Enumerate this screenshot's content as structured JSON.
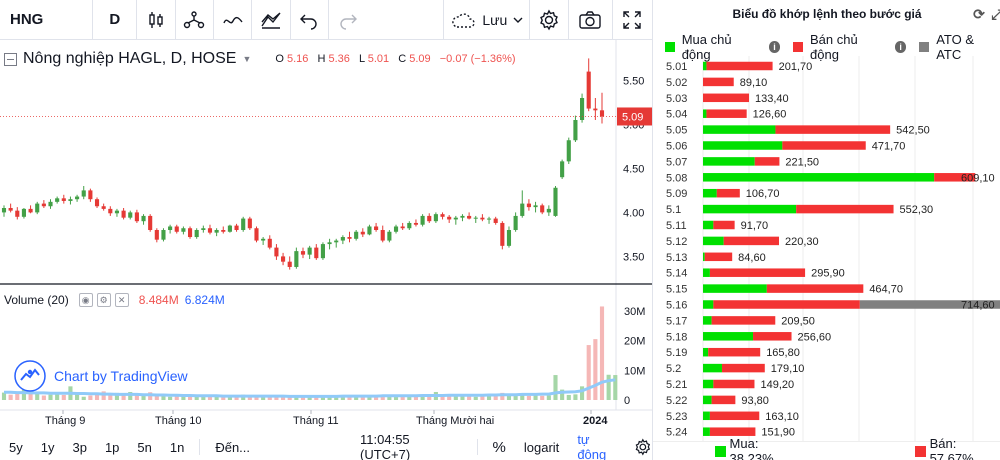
{
  "toolbar": {
    "symbol": "HNG",
    "interval": "D",
    "save_label": "Lưu"
  },
  "legend": {
    "title": "Nông nghiệp HAGL, D, HOSE",
    "o_key": "O",
    "o_val": "5.16",
    "h_key": "H",
    "h_val": "5.36",
    "l_key": "L",
    "l_val": "5.01",
    "c_key": "C",
    "c_val": "5.09",
    "change": "−0.07 (−1.36%)"
  },
  "volume_legend": {
    "label": "Volume (20)",
    "vol": "8.484M",
    "ma": "6.824M"
  },
  "watermark": "Chart by TradingView",
  "bottom": {
    "ranges": [
      "5y",
      "1y",
      "3p",
      "1p",
      "5n",
      "1n"
    ],
    "goto": "Đến...",
    "time": "11:04:55 (UTC+7)",
    "percent": "%",
    "log": "logarit",
    "auto": "tự động"
  },
  "colors": {
    "up": "#26a69a",
    "down": "#ef5350",
    "upCandle": "#43a047",
    "downCandle": "#e53935",
    "buy": "#00e000",
    "sell": "#f33333",
    "ato": "#808080",
    "accent": "#2962ff"
  },
  "chart_data": [
    {
      "type": "candlestick",
      "title": "Nông nghiệp HAGL, D, HOSE",
      "current_price": 5.09,
      "y_ticks": [
        "5.50",
        "5.00",
        "4.50",
        "4.00",
        "3.50"
      ],
      "ylim": [
        3.3,
        5.8
      ],
      "x_labels": [
        "Tháng 9",
        "Tháng 10",
        "Tháng 11",
        "Tháng Mười hai",
        "2024"
      ],
      "candles": [
        [
          4.0,
          4.08,
          3.95,
          4.05
        ],
        [
          4.05,
          4.1,
          4.0,
          4.02
        ],
        [
          4.02,
          4.06,
          3.92,
          3.95
        ],
        [
          3.95,
          4.05,
          3.93,
          4.04
        ],
        [
          4.04,
          4.08,
          3.99,
          4.0
        ],
        [
          4.0,
          4.12,
          3.98,
          4.1
        ],
        [
          4.1,
          4.14,
          4.05,
          4.07
        ],
        [
          4.07,
          4.15,
          4.04,
          4.12
        ],
        [
          4.12,
          4.18,
          4.1,
          4.16
        ],
        [
          4.16,
          4.2,
          4.1,
          4.13
        ],
        [
          4.13,
          4.18,
          4.09,
          4.15
        ],
        [
          4.15,
          4.2,
          4.12,
          4.18
        ],
        [
          4.18,
          4.3,
          4.15,
          4.25
        ],
        [
          4.25,
          4.27,
          4.12,
          4.15
        ],
        [
          4.15,
          4.17,
          4.05,
          4.07
        ],
        [
          4.07,
          4.1,
          4.02,
          4.04
        ],
        [
          4.04,
          4.07,
          3.96,
          3.99
        ],
        [
          3.99,
          4.04,
          3.95,
          4.02
        ],
        [
          4.02,
          4.05,
          3.92,
          3.94
        ],
        [
          3.94,
          4.02,
          3.92,
          4.0
        ],
        [
          4.0,
          4.03,
          3.88,
          3.9
        ],
        [
          3.9,
          3.98,
          3.86,
          3.96
        ],
        [
          3.96,
          3.98,
          3.78,
          3.8
        ],
        [
          3.8,
          3.82,
          3.66,
          3.69
        ],
        [
          3.69,
          3.82,
          3.67,
          3.8
        ],
        [
          3.8,
          3.86,
          3.76,
          3.84
        ],
        [
          3.84,
          3.86,
          3.76,
          3.78
        ],
        [
          3.78,
          3.84,
          3.75,
          3.82
        ],
        [
          3.82,
          3.84,
          3.7,
          3.72
        ],
        [
          3.72,
          3.82,
          3.7,
          3.8
        ],
        [
          3.8,
          3.85,
          3.77,
          3.82
        ],
        [
          3.82,
          3.86,
          3.75,
          3.77
        ],
        [
          3.77,
          3.82,
          3.73,
          3.8
        ],
        [
          3.8,
          3.84,
          3.76,
          3.78
        ],
        [
          3.78,
          3.86,
          3.77,
          3.85
        ],
        [
          3.85,
          3.87,
          3.78,
          3.8
        ],
        [
          3.8,
          3.95,
          3.78,
          3.93
        ],
        [
          3.93,
          3.95,
          3.8,
          3.82
        ],
        [
          3.82,
          3.84,
          3.66,
          3.68
        ],
        [
          3.68,
          3.72,
          3.63,
          3.7
        ],
        [
          3.7,
          3.74,
          3.58,
          3.6
        ],
        [
          3.6,
          3.64,
          3.46,
          3.5
        ],
        [
          3.5,
          3.54,
          3.4,
          3.44
        ],
        [
          3.44,
          3.5,
          3.35,
          3.38
        ],
        [
          3.38,
          3.6,
          3.36,
          3.56
        ],
        [
          3.56,
          3.6,
          3.48,
          3.52
        ],
        [
          3.52,
          3.62,
          3.47,
          3.6
        ],
        [
          3.6,
          3.64,
          3.46,
          3.48
        ],
        [
          3.48,
          3.66,
          3.46,
          3.64
        ],
        [
          3.64,
          3.7,
          3.58,
          3.66
        ],
        [
          3.66,
          3.7,
          3.6,
          3.68
        ],
        [
          3.68,
          3.74,
          3.64,
          3.72
        ],
        [
          3.72,
          3.78,
          3.66,
          3.7
        ],
        [
          3.7,
          3.8,
          3.68,
          3.78
        ],
        [
          3.78,
          3.82,
          3.72,
          3.75
        ],
        [
          3.75,
          3.86,
          3.74,
          3.84
        ],
        [
          3.84,
          3.88,
          3.78,
          3.8
        ],
        [
          3.8,
          3.85,
          3.66,
          3.68
        ],
        [
          3.68,
          3.8,
          3.66,
          3.78
        ],
        [
          3.78,
          3.86,
          3.76,
          3.84
        ],
        [
          3.84,
          3.88,
          3.8,
          3.82
        ],
        [
          3.82,
          3.9,
          3.8,
          3.88
        ],
        [
          3.88,
          3.92,
          3.84,
          3.86
        ],
        [
          3.86,
          3.98,
          3.84,
          3.96
        ],
        [
          3.96,
          3.99,
          3.88,
          3.9
        ],
        [
          3.9,
          4.0,
          3.88,
          3.98
        ],
        [
          3.98,
          4.0,
          3.92,
          3.95
        ],
        [
          3.95,
          3.97,
          3.88,
          3.92
        ],
        [
          3.92,
          3.96,
          3.86,
          3.94
        ],
        [
          3.94,
          3.98,
          3.9,
          3.96
        ],
        [
          3.96,
          4.0,
          3.92,
          3.93
        ],
        [
          3.93,
          3.96,
          3.88,
          3.94
        ],
        [
          3.94,
          3.98,
          3.9,
          3.92
        ],
        [
          3.92,
          3.95,
          3.87,
          3.93
        ],
        [
          3.93,
          3.95,
          3.86,
          3.88
        ],
        [
          3.88,
          3.9,
          3.58,
          3.62
        ],
        [
          3.62,
          3.84,
          3.6,
          3.8
        ],
        [
          3.8,
          4.0,
          3.78,
          3.96
        ],
        [
          3.96,
          4.25,
          3.94,
          4.1
        ],
        [
          4.1,
          4.15,
          4.02,
          4.06
        ],
        [
          4.06,
          4.12,
          4.0,
          4.08
        ],
        [
          4.08,
          4.1,
          3.98,
          4.0
        ],
        [
          4.0,
          4.08,
          3.96,
          4.04
        ],
        [
          3.96,
          4.3,
          3.95,
          4.28
        ],
        [
          4.4,
          4.6,
          4.38,
          4.58
        ],
        [
          4.58,
          4.85,
          4.55,
          4.82
        ],
        [
          4.82,
          5.1,
          4.8,
          5.05
        ],
        [
          5.05,
          5.35,
          5.02,
          5.3
        ],
        [
          5.6,
          5.75,
          5.15,
          5.18
        ],
        [
          5.18,
          5.3,
          5.05,
          5.16
        ],
        [
          5.16,
          5.36,
          5.01,
          5.09
        ]
      ],
      "volume": {
        "label": "Volume (20)",
        "y_ticks": [
          "30M",
          "20M",
          "10M",
          "0"
        ],
        "values": [
          2.5,
          1.8,
          2.2,
          4.1,
          3.8,
          2.2,
          1.5,
          1.8,
          2.1,
          1.7,
          4.6,
          1.9,
          1.1,
          1.5,
          1.7,
          2.9,
          1.7,
          2.4,
          1.6,
          2.7,
          2.2,
          1.5,
          2.6,
          1.8,
          1.6,
          1.1,
          1.5,
          1.9,
          1.7,
          1.1,
          1.3,
          1.2,
          1.4,
          1.0,
          1.6,
          1.3,
          1.8,
          1.3,
          1.4,
          1.2,
          1.3,
          1.1,
          1.2,
          1.0,
          1.5,
          1.1,
          1.4,
          1.2,
          1.0,
          1.1,
          1.6,
          1.2,
          1.3,
          1.0,
          1.7,
          1.4,
          1.6,
          1.2,
          1.4,
          1.0,
          1.3,
          1.6,
          1.1,
          1.7,
          2.0,
          2.7,
          1.8,
          1.3,
          1.6,
          1.2,
          1.4,
          1.1,
          1.5,
          1.4,
          1.7,
          2.4,
          1.9,
          1.6,
          2.2,
          1.4,
          1.7,
          1.4,
          1.5,
          8.4,
          3.5,
          1.7,
          1.9,
          4.6,
          18.5,
          20.5,
          31.5,
          8.5,
          8.4
        ],
        "ma": [
          2.6,
          2.6,
          2.5,
          2.5,
          2.4,
          2.4,
          2.4,
          2.3,
          2.3,
          2.3,
          2.3,
          2.2,
          2.2,
          2.1,
          2.1,
          2.0,
          2.0,
          1.9,
          1.9,
          1.9,
          1.9,
          1.8,
          1.8,
          1.7,
          1.7,
          1.6,
          1.6,
          1.5,
          1.5,
          1.4,
          1.4,
          1.4,
          1.4,
          1.3,
          1.3,
          1.3,
          1.3,
          1.3,
          1.3,
          1.3,
          1.3,
          1.3,
          1.3,
          1.2,
          1.2,
          1.2,
          1.2,
          1.2,
          1.2,
          1.2,
          1.2,
          1.3,
          1.3,
          1.3,
          1.3,
          1.3,
          1.3,
          1.4,
          1.4,
          1.4,
          1.4,
          1.4,
          1.4,
          1.5,
          1.5,
          1.5,
          1.5,
          1.6,
          1.6,
          1.6,
          1.6,
          1.6,
          1.6,
          1.7,
          1.7,
          1.8,
          1.8,
          1.8,
          1.9,
          1.9,
          1.9,
          2.0,
          2.0,
          2.4,
          2.6,
          2.7,
          2.8,
          3.1,
          4.0,
          4.9,
          6.0,
          6.5,
          6.8
        ]
      }
    },
    {
      "type": "bar",
      "title": "Biểu đồ khớp lệnh theo bước giá",
      "legend": [
        "Mua chủ động",
        "Bán chủ động",
        "ATO & ATC"
      ],
      "categories": [
        "5.01",
        "5.02",
        "5.03",
        "5.04",
        "5.05",
        "5.06",
        "5.07",
        "5.08",
        "5.09",
        "5.1",
        "5.11",
        "5.12",
        "5.13",
        "5.14",
        "5.15",
        "5.16",
        "5.17",
        "5.18",
        "5.19",
        "5.2",
        "5.21",
        "5.22",
        "5.23",
        "5.24"
      ],
      "totals": [
        "201,70",
        "89,10",
        "133,40",
        "126,60",
        "542,50",
        "471,70",
        "221,50",
        "609,10",
        "106,70",
        "552,30",
        "91,70",
        "220,30",
        "84,60",
        "295,90",
        "464,70",
        "714,60",
        "209,50",
        "256,60",
        "165,80",
        "179,10",
        "149,20",
        "93,80",
        "163,10",
        "151,90"
      ],
      "buy": [
        10,
        0,
        0,
        10,
        210,
        230,
        150,
        670,
        40,
        270,
        30,
        60,
        5,
        20,
        185,
        30,
        25,
        145,
        15,
        55,
        30,
        25,
        20,
        20
      ],
      "sell": [
        191.7,
        89.1,
        133.4,
        116.6,
        332.5,
        241.7,
        71.5,
        119.1,
        66.7,
        282.3,
        61.7,
        160.3,
        79.6,
        275.9,
        279.7,
        424.6,
        184.5,
        111.6,
        150.8,
        124.1,
        119.2,
        68.8,
        143.1,
        131.9
      ],
      "ato": [
        0,
        0,
        0,
        0,
        0,
        0,
        0,
        0,
        0,
        0,
        0,
        0,
        0,
        0,
        0,
        460,
        0,
        0,
        0,
        0,
        0,
        0,
        0,
        0
      ],
      "summary": {
        "buy_label": "Mua: 38.23%",
        "sell_label": "Bán: 57.67%"
      }
    }
  ]
}
